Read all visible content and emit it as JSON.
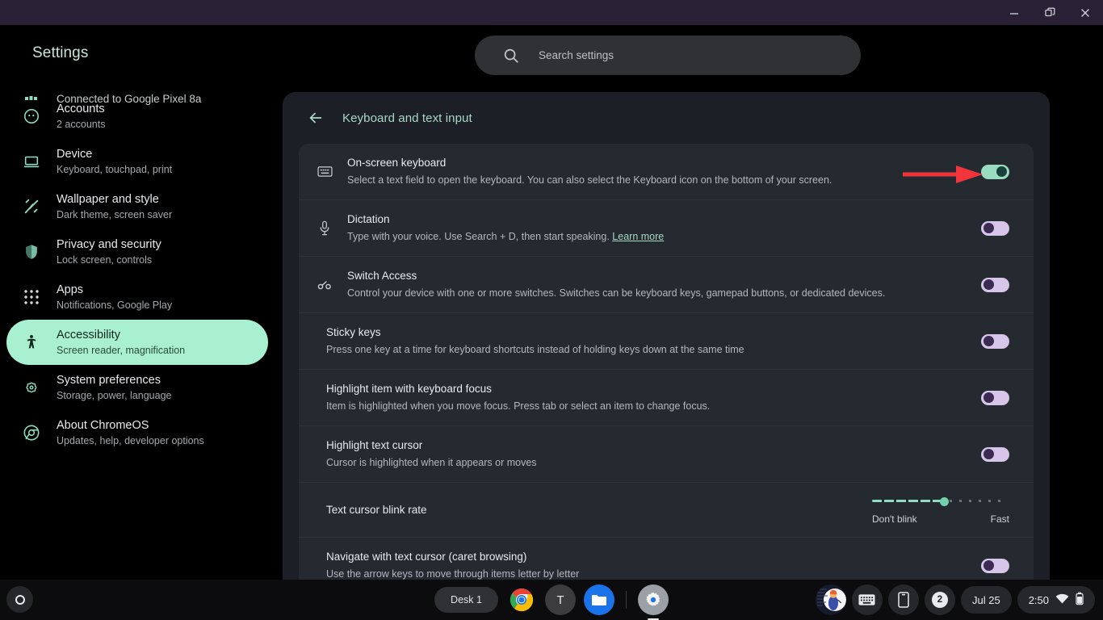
{
  "window": {
    "minimize_label": "Minimize",
    "restore_label": "Restore",
    "close_label": "Close"
  },
  "app": {
    "title": "Settings"
  },
  "search": {
    "placeholder": "Search settings",
    "icon": "search-icon"
  },
  "sidebar": {
    "partial_item": {
      "label": "Connected to Google Pixel 8a",
      "icon": "bluetooth-icon"
    },
    "items": [
      {
        "title": "Accounts",
        "subtitle": "2 accounts",
        "icon": "person-circle-icon",
        "selected": false
      },
      {
        "title": "Device",
        "subtitle": "Keyboard, touchpad, print",
        "icon": "laptop-icon",
        "selected": false
      },
      {
        "title": "Wallpaper and style",
        "subtitle": "Dark theme, screen saver",
        "icon": "brush-icon",
        "selected": false
      },
      {
        "title": "Privacy and security",
        "subtitle": "Lock screen, controls",
        "icon": "shield-icon",
        "selected": false
      },
      {
        "title": "Apps",
        "subtitle": "Notifications, Google Play",
        "icon": "grid-apps-icon",
        "selected": false
      },
      {
        "title": "Accessibility",
        "subtitle": "Screen reader, magnification",
        "icon": "accessibility-icon",
        "selected": true
      },
      {
        "title": "System preferences",
        "subtitle": "Storage, power, language",
        "icon": "gear-icon",
        "selected": false
      },
      {
        "title": "About ChromeOS",
        "subtitle": "Updates, help, developer options",
        "icon": "chrome-icon",
        "selected": false
      }
    ]
  },
  "main": {
    "back_icon": "back-arrow-icon",
    "page_title": "Keyboard and text input",
    "rows": [
      {
        "title": "On-screen keyboard",
        "subtitle": "Select a text field to open the keyboard. You can also select the Keyboard icon on the bottom of your screen.",
        "icon": "keyboard-icon",
        "control": "toggle",
        "toggle_state": "on"
      },
      {
        "title": "Dictation",
        "subtitle": "Type with your voice. Use Search + D, then start speaking.",
        "link_text": "Learn more",
        "icon": "microphone-icon",
        "control": "toggle",
        "toggle_state": "off"
      },
      {
        "title": "Switch Access",
        "subtitle": "Control your device with one or more switches. Switches can be keyboard keys, gamepad buttons, or dedicated devices.",
        "icon": "switch-access-icon",
        "control": "toggle",
        "toggle_state": "off"
      },
      {
        "title": "Sticky keys",
        "subtitle": "Press one key at a time for keyboard shortcuts instead of holding keys down at the same time",
        "icon": "",
        "control": "toggle",
        "toggle_state": "off"
      },
      {
        "title": "Highlight item with keyboard focus",
        "subtitle": "Item is highlighted when you move focus. Press tab or select an item to change focus.",
        "icon": "",
        "control": "toggle",
        "toggle_state": "off"
      },
      {
        "title": "Highlight text cursor",
        "subtitle": "Cursor is highlighted when it appears or moves",
        "icon": "",
        "control": "toggle",
        "toggle_state": "off"
      },
      {
        "title": "Text cursor blink rate",
        "subtitle": "",
        "icon": "",
        "control": "slider",
        "slider": {
          "min_label": "Don't blink",
          "max_label": "Fast",
          "value_percent": 53
        }
      },
      {
        "title": "Navigate with text cursor (caret browsing)",
        "subtitle": "Use the arrow keys to move through items letter by letter",
        "icon": "",
        "control": "toggle",
        "toggle_state": "off"
      }
    ]
  },
  "annotation": {
    "arrow_color": "#f2353c",
    "points_to": "on-screen-keyboard-toggle"
  },
  "shelf": {
    "launcher_icon": "launcher-icon",
    "desk_label": "Desk 1",
    "apps": [
      {
        "name": "chrome-app-icon",
        "label": "Chrome"
      },
      {
        "name": "terminal-app-icon",
        "label": "T"
      },
      {
        "name": "files-app-icon",
        "label": "Files"
      },
      {
        "name": "settings-app-icon",
        "label": "Settings"
      }
    ],
    "status": {
      "avatar_icon": "avatar",
      "keyboard_icon": "onscreen-keyboard-icon",
      "phone_icon": "phone-hub-icon",
      "notification_count": "2",
      "date": "Jul 25",
      "time": "2:50",
      "network_icon": "wifi-icon",
      "battery_icon": "battery-icon"
    }
  },
  "colors": {
    "accent_mint": "#a8f0cf",
    "toggle_off_track": "#d7c6ea",
    "toggle_on_track": "#99dcc2",
    "titlebar": "#2b2136",
    "card": "#252930"
  }
}
